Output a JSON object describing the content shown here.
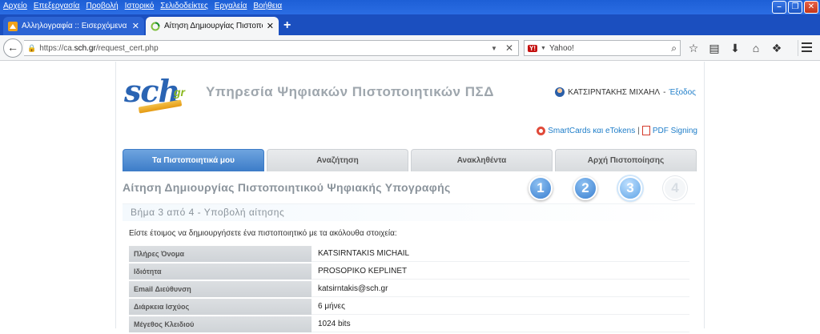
{
  "menu": [
    "Αρχείο",
    "Επεξεργασία",
    "Προβολή",
    "Ιστορικό",
    "Σελιδοδείκτες",
    "Εργαλεία",
    "Βοήθεια"
  ],
  "tabs": [
    {
      "label": "Αλληλογραφία :: Εισερχόμενα",
      "active": false
    },
    {
      "label": "Αίτηση Δημιουργίας Πιστοποιη...",
      "active": true
    }
  ],
  "browser": {
    "url_prefix": "https://ca.",
    "url_host": "sch.gr",
    "url_path": "/request_cert.php",
    "search_placeholder": "Yahoo!"
  },
  "header": {
    "logo_text": "sch",
    "logo_suffix": "gr",
    "service_title": "Υπηρεσία Ψηφιακών Πιστοποιητικών ΠΣΔ",
    "user_name": "ΚΑΤΣΙΡΝΤΑΚΗΣ ΜΙΧΑΗΛ",
    "user_sep": " - ",
    "logout": "Έξοδος",
    "link_smartcards": "SmartCards και eTokens",
    "link_sep": "|",
    "link_pdf": "PDF Signing"
  },
  "nav_tabs": [
    "Τα Πιστοποιητικά μου",
    "Αναζήτηση",
    "Ανακληθέντα",
    "Αρχή Πιστοποίησης"
  ],
  "page_title": "Αίτηση Δημιουργίας Πιστοποιητικού Ψηφιακής Υπογραφής",
  "steps": [
    "1",
    "2",
    "3",
    "4"
  ],
  "current_step": 3,
  "step_heading": "Βήμα 3 από 4 - Υποβολή αίτησης",
  "intro": "Είστε έτοιμος να δημιουργήσετε ένα πιστοποιητικό με τα ακόλουθα στοιχεία:",
  "details": [
    {
      "label": "Πλήρες Όνομα",
      "value": "KATSIRNTAKIS MICHAIL"
    },
    {
      "label": "Ιδιότητα",
      "value": "PROSOPIKO KEPLINET"
    },
    {
      "label": "Email Διεύθυνση",
      "value": "katsirntakis@sch.gr"
    },
    {
      "label": "Διάρκεια Ισχύος",
      "value": "6 μήνες"
    },
    {
      "label": "Μέγεθος Κλειδιού",
      "value": "1024 bits"
    }
  ],
  "colors": {
    "accent": "#3c7cc8",
    "link": "#1f7ec9",
    "title_gray": "#9ea6ad"
  }
}
